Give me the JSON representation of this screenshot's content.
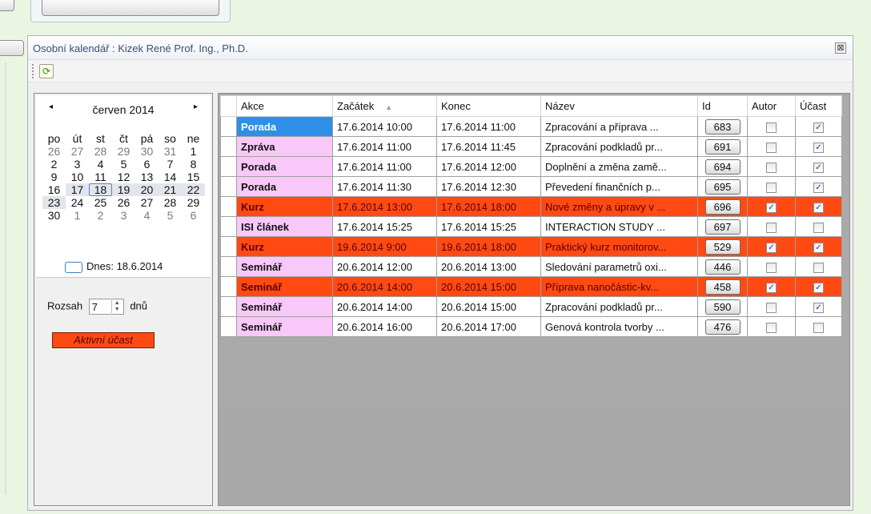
{
  "window": {
    "title": "Osobní kalendář : Kizek René Prof. Ing., Ph.D.",
    "close_glyph": "⊠"
  },
  "toolbar": {
    "refresh_icon": "refresh-icon"
  },
  "calendar": {
    "prev": "◂",
    "next": "▸",
    "month": "červen 2014",
    "weekdays": [
      "po",
      "út",
      "st",
      "čt",
      "pá",
      "so",
      "ne"
    ],
    "weeks": [
      [
        "26",
        "27",
        "28",
        "29",
        "30",
        "31",
        "1"
      ],
      [
        "2",
        "3",
        "4",
        "5",
        "6",
        "7",
        "8"
      ],
      [
        "9",
        "10",
        "11",
        "12",
        "13",
        "14",
        "15"
      ],
      [
        "16",
        "17",
        "18",
        "19",
        "20",
        "21",
        "22"
      ],
      [
        "23",
        "24",
        "25",
        "26",
        "27",
        "28",
        "29"
      ],
      [
        "30",
        "1",
        "2",
        "3",
        "4",
        "5",
        "6"
      ]
    ],
    "today_label": "Dnes: 18.6.2014"
  },
  "range": {
    "label": "Rozsah",
    "value": "7",
    "unit": "dnů"
  },
  "legend": {
    "active": "Aktivní účast"
  },
  "grid": {
    "columns": [
      "Akce",
      "Začátek",
      "Konec",
      "Název",
      "Id",
      "Autor",
      "Účast"
    ],
    "sort_indicator": "▲",
    "rows": [
      {
        "akce": "Porada",
        "zacatek": "17.6.2014 10:00",
        "konec": "17.6.2014 11:00",
        "nazev": "Zpracování a příprava ...",
        "id": "683",
        "autor": false,
        "ucast": true,
        "color": "#2f8fe6",
        "active": false
      },
      {
        "akce": "Zpráva",
        "zacatek": "17.6.2014 11:00",
        "konec": "17.6.2014 11:45",
        "nazev": "Zpracování podkladů pr...",
        "id": "691",
        "autor": false,
        "ucast": true,
        "color": "#f8c8f8",
        "active": false
      },
      {
        "akce": "Porada",
        "zacatek": "17.6.2014 11:00",
        "konec": "17.6.2014 12:00",
        "nazev": "Doplnění a změna zamě...",
        "id": "694",
        "autor": false,
        "ucast": true,
        "color": "#f8c8f8",
        "active": false
      },
      {
        "akce": "Porada",
        "zacatek": "17.6.2014 11:30",
        "konec": "17.6.2014 12:30",
        "nazev": "Převedení finančních p...",
        "id": "695",
        "autor": false,
        "ucast": true,
        "color": "#f8c8f8",
        "active": false
      },
      {
        "akce": "Kurz",
        "zacatek": "17.6.2014 13:00",
        "konec": "17.6.2014 18:00",
        "nazev": "Nové změny a úpravy v ...",
        "id": "696",
        "autor": true,
        "ucast": true,
        "color": "#ff4a14",
        "active": true
      },
      {
        "akce": "ISI článek",
        "zacatek": "17.6.2014 15:25",
        "konec": "17.6.2014 15:25",
        "nazev": "INTERACTION STUDY ...",
        "id": "697",
        "autor": false,
        "ucast": false,
        "color": "#f8c8f8",
        "active": false
      },
      {
        "akce": "Kurz",
        "zacatek": "19.6.2014 9:00",
        "konec": "19.6.2014 18:00",
        "nazev": "Praktický kurz monitorov...",
        "id": "529",
        "autor": true,
        "ucast": true,
        "color": "#ff4a14",
        "active": true
      },
      {
        "akce": "Seminář",
        "zacatek": "20.6.2014 12:00",
        "konec": "20.6.2014 13:00",
        "nazev": "Sledování parametrů oxi...",
        "id": "446",
        "autor": false,
        "ucast": false,
        "color": "#f8c8f8",
        "active": false
      },
      {
        "akce": "Seminář",
        "zacatek": "20.6.2014 14:00",
        "konec": "20.6.2014 15:00",
        "nazev": "Příprava nanočástic-kv...",
        "id": "458",
        "autor": true,
        "ucast": true,
        "color": "#ff4a14",
        "active": true
      },
      {
        "akce": "Seminář",
        "zacatek": "20.6.2014 14:00",
        "konec": "20.6.2014 15:00",
        "nazev": "Zpracování podkladů pr...",
        "id": "590",
        "autor": false,
        "ucast": true,
        "color": "#f8c8f8",
        "active": false
      },
      {
        "akce": "Seminář",
        "zacatek": "20.6.2014 16:00",
        "konec": "20.6.2014 17:00",
        "nazev": "Genová kontrola tvorby ...",
        "id": "476",
        "autor": false,
        "ucast": false,
        "color": "#f8c8f8",
        "active": false
      }
    ]
  }
}
